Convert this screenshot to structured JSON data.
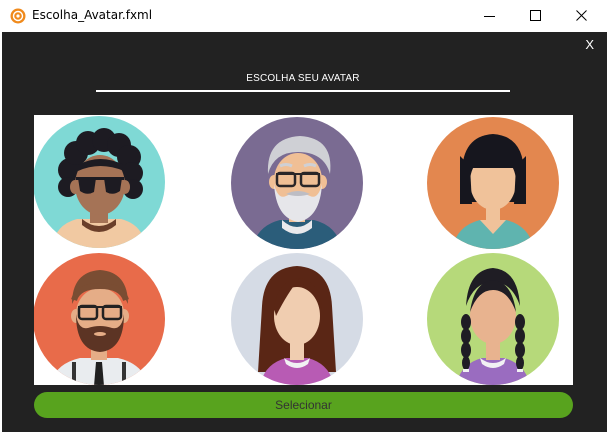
{
  "window": {
    "title": "Escolha_Avatar.fxml"
  },
  "dialog": {
    "close_label": "X",
    "heading": "ESCOLHA SEU AVATAR",
    "select_label": "Selecionar"
  },
  "avatars": [
    {
      "name": "avatar-curly-hair-sunglasses",
      "bg": "#7fd9d5"
    },
    {
      "name": "avatar-old-man-beard",
      "bg": "#7a6b92"
    },
    {
      "name": "avatar-woman-black-bob",
      "bg": "#e3874f"
    },
    {
      "name": "avatar-bearded-man-glasses",
      "bg": "#e86b4a"
    },
    {
      "name": "avatar-woman-long-brown-hair",
      "bg": "#d5dbe5"
    },
    {
      "name": "avatar-woman-braids",
      "bg": "#b6d97a"
    }
  ],
  "colors": {
    "accent": "#58a31e",
    "background": "#222222"
  }
}
